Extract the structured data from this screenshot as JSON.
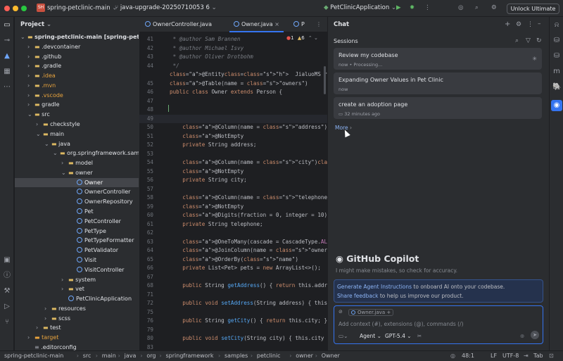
{
  "titlebar": {
    "project_badge": "SH",
    "project": "spring-petclinic-main",
    "branch": "java-upgrade-20250710053 6",
    "run_config": "PetClinicApplication",
    "unlock": "Unlock Ultimate"
  },
  "project_panel": {
    "title": "Project",
    "rows": [
      {
        "label": "spring-petclinic-main [spring-petclinic]",
        "kind": "folder"
      },
      {
        "label": ".devcontainer",
        "kind": "folder"
      },
      {
        "label": ".github",
        "kind": "folder"
      },
      {
        "label": ".gradle",
        "kind": "folder"
      },
      {
        "label": ".idea",
        "kind": "folder"
      },
      {
        "label": ".mvn",
        "kind": "folder"
      },
      {
        "label": ".vscode",
        "kind": "folder"
      },
      {
        "label": "gradle",
        "kind": "folder"
      },
      {
        "label": "src",
        "kind": "folder"
      },
      {
        "label": "checkstyle",
        "kind": "folder"
      },
      {
        "label": "main",
        "kind": "folder"
      },
      {
        "label": "java",
        "kind": "folder"
      },
      {
        "label": "org.springframework.samples",
        "kind": "folder"
      },
      {
        "label": "model",
        "kind": "folder"
      },
      {
        "label": "owner",
        "kind": "folder"
      },
      {
        "label": "Owner",
        "kind": "class"
      },
      {
        "label": "OwnerController",
        "kind": "class"
      },
      {
        "label": "OwnerRepository",
        "kind": "class"
      },
      {
        "label": "Pet",
        "kind": "class"
      },
      {
        "label": "PetController",
        "kind": "class"
      },
      {
        "label": "PetType",
        "kind": "class"
      },
      {
        "label": "PetTypeFormatter",
        "kind": "class"
      },
      {
        "label": "PetValidator",
        "kind": "class"
      },
      {
        "label": "Visit",
        "kind": "class"
      },
      {
        "label": "VisitController",
        "kind": "class"
      },
      {
        "label": "system",
        "kind": "folder"
      },
      {
        "label": "vet",
        "kind": "folder"
      },
      {
        "label": "PetClinicApplication",
        "kind": "class"
      },
      {
        "label": "resources",
        "kind": "folder"
      },
      {
        "label": "scss",
        "kind": "folder"
      },
      {
        "label": "test",
        "kind": "folder"
      },
      {
        "label": "target",
        "kind": "folder"
      },
      {
        "label": ".editorconfig",
        "kind": "file"
      }
    ]
  },
  "editor": {
    "tabs": [
      "OwnerController.java",
      "Owner.java",
      "P"
    ],
    "active_tab": "Owner.java",
    "problems": {
      "errors": "1",
      "warnings": "6"
    },
    "lines": [
      {
        "n": "41",
        "t": " * @author Sam Brannen"
      },
      {
        "n": "42",
        "t": " * @author Michael Isvy"
      },
      {
        "n": "43",
        "t": " * @author Oliver Drotbohm"
      },
      {
        "n": "44",
        "t": " */"
      },
      {
        "n": "",
        "t": "@Entity  JialuoMS *"
      },
      {
        "n": "45",
        "t": "@Table(name = \"owners\")"
      },
      {
        "n": "46",
        "t": "public class Owner extends Person {"
      },
      {
        "n": "47",
        "t": ""
      },
      {
        "n": "48",
        "t": ""
      },
      {
        "n": "49",
        "t": ""
      },
      {
        "n": "50",
        "t": "    @Column(name = \"address\")  3 usages"
      },
      {
        "n": "51",
        "t": "    @NotEmpty"
      },
      {
        "n": "52",
        "t": "    private String address;"
      },
      {
        "n": "53",
        "t": ""
      },
      {
        "n": "54",
        "t": "    @Column(name = \"city\")  3 usages"
      },
      {
        "n": "55",
        "t": "    @NotEmpty"
      },
      {
        "n": "56",
        "t": "    private String city;"
      },
      {
        "n": "57",
        "t": ""
      },
      {
        "n": "58",
        "t": "    @Column(name = \"telephone\")  3 usages"
      },
      {
        "n": "59",
        "t": "    @NotEmpty"
      },
      {
        "n": "60",
        "t": "    @Digits(fraction = 0, integer = 10)"
      },
      {
        "n": "61",
        "t": "    private String telephone;"
      },
      {
        "n": "62",
        "t": ""
      },
      {
        "n": "63",
        "t": "    @OneToMany(cascade = CascadeType.ALL, fetch ="
      },
      {
        "n": "64",
        "t": "    @JoinColumn(name = \"owner_id\")"
      },
      {
        "n": "65",
        "t": "    @OrderBy(\"name\")"
      },
      {
        "n": "66",
        "t": "    private List<Pet> pets = new ArrayList<>();"
      },
      {
        "n": "67",
        "t": ""
      },
      {
        "n": "68",
        "t": "    public String getAddress() { return this.addre"
      },
      {
        "n": "71",
        "t": ""
      },
      {
        "n": "72",
        "t": "    public void setAddress(String address) { this."
      },
      {
        "n": "75",
        "t": ""
      },
      {
        "n": "76",
        "t": "    public String getCity() { return this.city; }"
      },
      {
        "n": "79",
        "t": ""
      },
      {
        "n": "80",
        "t": "    public void setCity(String city) { this.city ="
      },
      {
        "n": "83",
        "t": ""
      },
      {
        "n": "84",
        "t": "    public String getTelephone() { return this.tel"
      }
    ]
  },
  "chat": {
    "title": "Chat",
    "sessions_label": "Sessions",
    "sessions": [
      {
        "title": "Review my codebase",
        "status": "now • Processing..."
      },
      {
        "title": "Expanding Owner Values in Pet Clinic",
        "status": "now"
      },
      {
        "title": "create an adoption page",
        "status": "32 minutes ago"
      }
    ],
    "more": "More",
    "copilot_title": "GitHub Copilot",
    "disclaimer": "I might make mistakes, so check for accuracy.",
    "gen_link": "Generate Agent Instructions",
    "gen_text": " to onboard AI onto your codebase.",
    "share_link": "Share feedback",
    "share_text": " to help us improve our product.",
    "context_file": "Owner.java",
    "input_placeholder": "Add context (#), extensions (@), commands (/)",
    "mode": "Agent",
    "model": "GPT-5.4"
  },
  "statusbar": {
    "breadcrumb": [
      "spring-petclinic-main",
      "src",
      "main",
      "java",
      "org",
      "springframework",
      "samples",
      "petclinic",
      "owner",
      "Owner"
    ],
    "position": "48:1",
    "line_sep": "LF",
    "encoding": "UTF-8",
    "indent": "Tab"
  },
  "colors": {
    "accent": "#3574f0",
    "project_badge": "#c9503f",
    "folder": "#dcb862"
  }
}
